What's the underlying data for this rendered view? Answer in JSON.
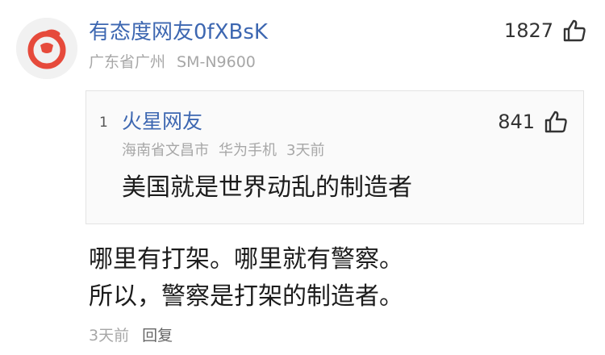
{
  "comment": {
    "username": "有态度网友0fXBsK",
    "location": "广东省广州",
    "device": "SM-N9600",
    "likes": "1827",
    "lines": [
      "哪里有打架。哪里就有警察。",
      "所以，警察是打架的制造者。"
    ],
    "time": "3天前",
    "reply_label": "回复"
  },
  "quoted": {
    "floor": "1",
    "username": "火星网友",
    "location": "海南省文昌市",
    "device": "华为手机",
    "time": "3天前",
    "likes": "841",
    "text": "美国就是世界动乱的制造者"
  },
  "icons": {
    "avatar": "netease-logo-icon",
    "like": "thumbs-up-icon"
  },
  "colors": {
    "username": "#3d67b1",
    "meta": "#a7a7a7",
    "avatar_red": "#e64a3b"
  }
}
